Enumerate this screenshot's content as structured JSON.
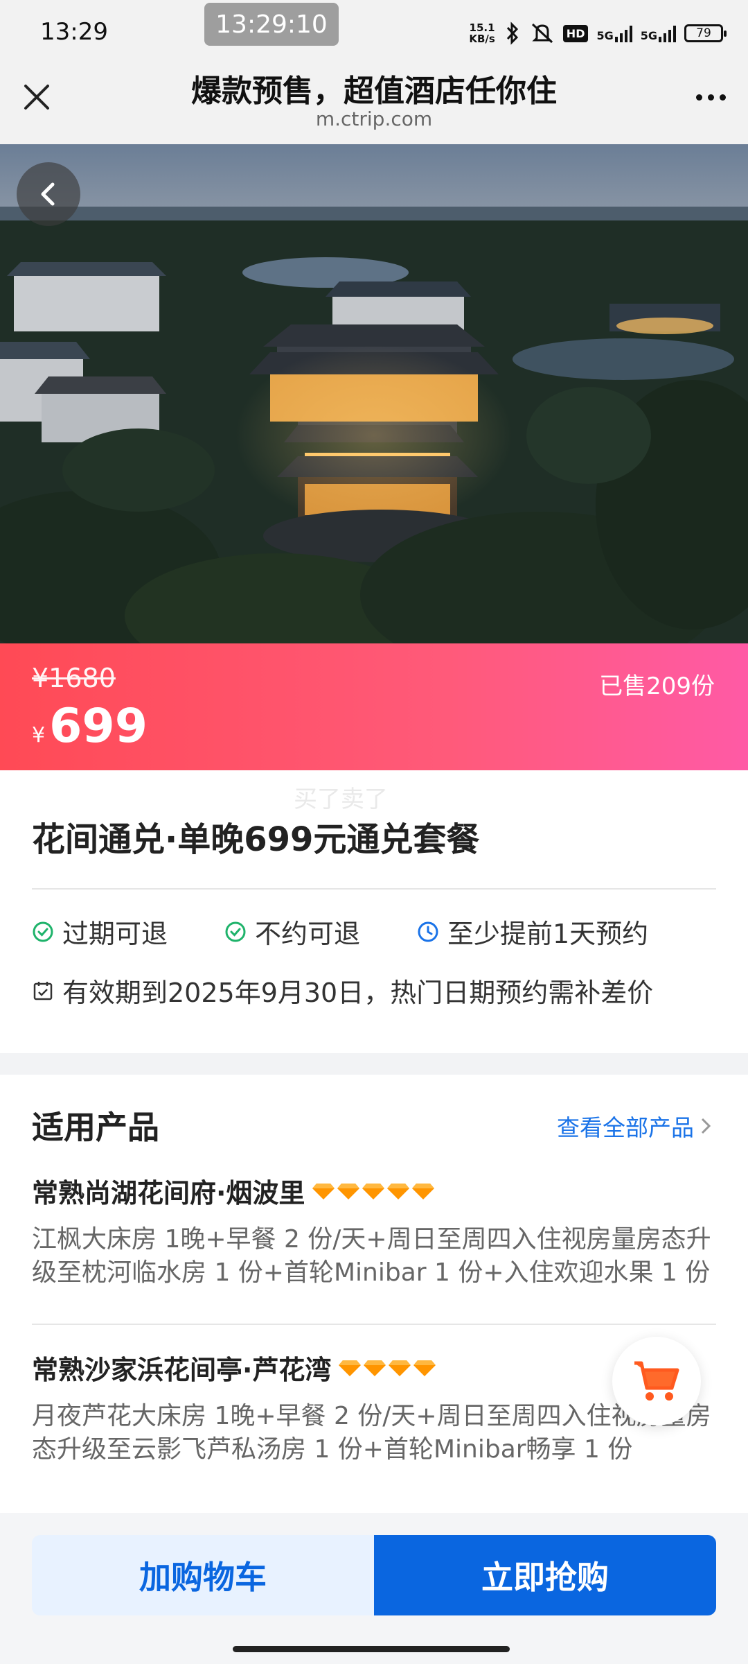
{
  "status_bar": {
    "time": "13:29",
    "screen_clock": "13:29:10",
    "net_speed_value": "15.1",
    "net_speed_unit": "KB/s",
    "hd_label": "HD",
    "signal1_label": "5G",
    "signal2_label": "5G",
    "battery": "79"
  },
  "header": {
    "title": "爆款预售，超值酒店任你住",
    "url": "m.ctrip.com"
  },
  "price": {
    "original": "¥1680",
    "currency": "¥",
    "current": "699",
    "sold": "已售209份"
  },
  "product": {
    "watermark": "买了卖了",
    "title": "花间通兑·单晚699元通兑套餐",
    "tags": [
      "过期可退",
      "不约可退",
      "至少提前1天预约"
    ],
    "validity": "有效期到2025年9月30日，热门日期预约需补差价"
  },
  "applicable": {
    "section_title": "适用产品",
    "view_all": "查看全部产品",
    "hotels": [
      {
        "name": "常熟尚湖花间府·烟波里",
        "diamonds": 5,
        "desc": "江枫大床房 1晚+早餐 2 份/天+周日至周四入住视房量房态升级至枕河临水房 1 份+首轮Minibar 1 份+入住欢迎水果 1 份"
      },
      {
        "name": "常熟沙家浜花间亭·芦花湾",
        "diamonds": 4,
        "desc": "月夜芦花大床房 1晚+早餐 2 份/天+周日至周四入住视房量房态升级至云影飞芦私汤房 1 份+首轮Minibar畅享 1 份"
      }
    ]
  },
  "bottom": {
    "add_cart": "加购物车",
    "buy_now": "立即抢购"
  },
  "colors": {
    "accent_blue": "#0a66e0",
    "price_gradient_start": "#ff4a55",
    "price_gradient_end": "#ff5aa5",
    "diamond": "#ff9500",
    "check_green": "#1fb36b",
    "clock_blue": "#1a73e8"
  },
  "icons": {
    "close": "close-icon",
    "more": "more-dots-icon",
    "back": "chevron-left-icon",
    "cart": "shopping-cart-icon"
  }
}
